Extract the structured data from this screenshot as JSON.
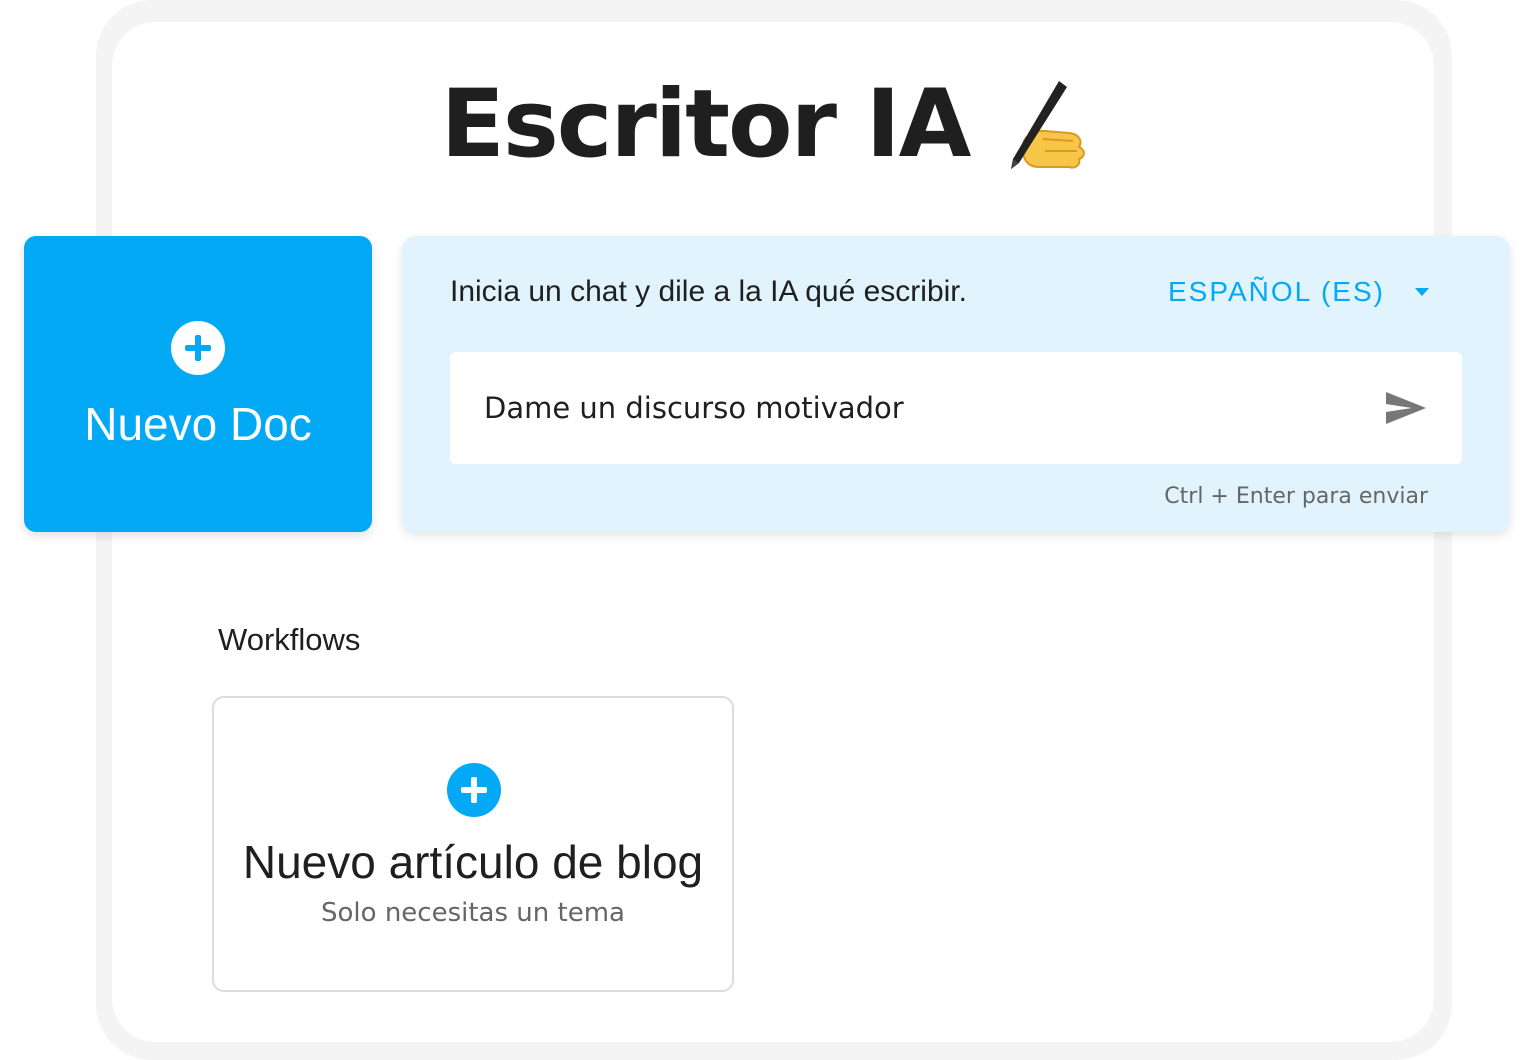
{
  "header": {
    "title": "Escritor IA",
    "title_icon": "writing-hand-icon"
  },
  "new_doc": {
    "label": "Nuevo Doc",
    "icon": "plus-circle-icon"
  },
  "chat": {
    "prompt": "Inicia un chat y dile a la IA qué escribir.",
    "language": "ESPAÑOL (ES)",
    "input_value": "Dame un discurso motivador",
    "send_icon": "send-icon",
    "hint": "Ctrl + Enter para enviar"
  },
  "workflows": {
    "section_title": "Workflows",
    "items": [
      {
        "title": "Nuevo artículo de blog",
        "subtitle": "Solo necesitas un tema",
        "icon": "plus-circle-icon"
      }
    ]
  },
  "colors": {
    "accent": "#03a9f4",
    "panel_bg": "#e1f3fd",
    "text": "#1f1f1f",
    "muted": "#666666"
  }
}
